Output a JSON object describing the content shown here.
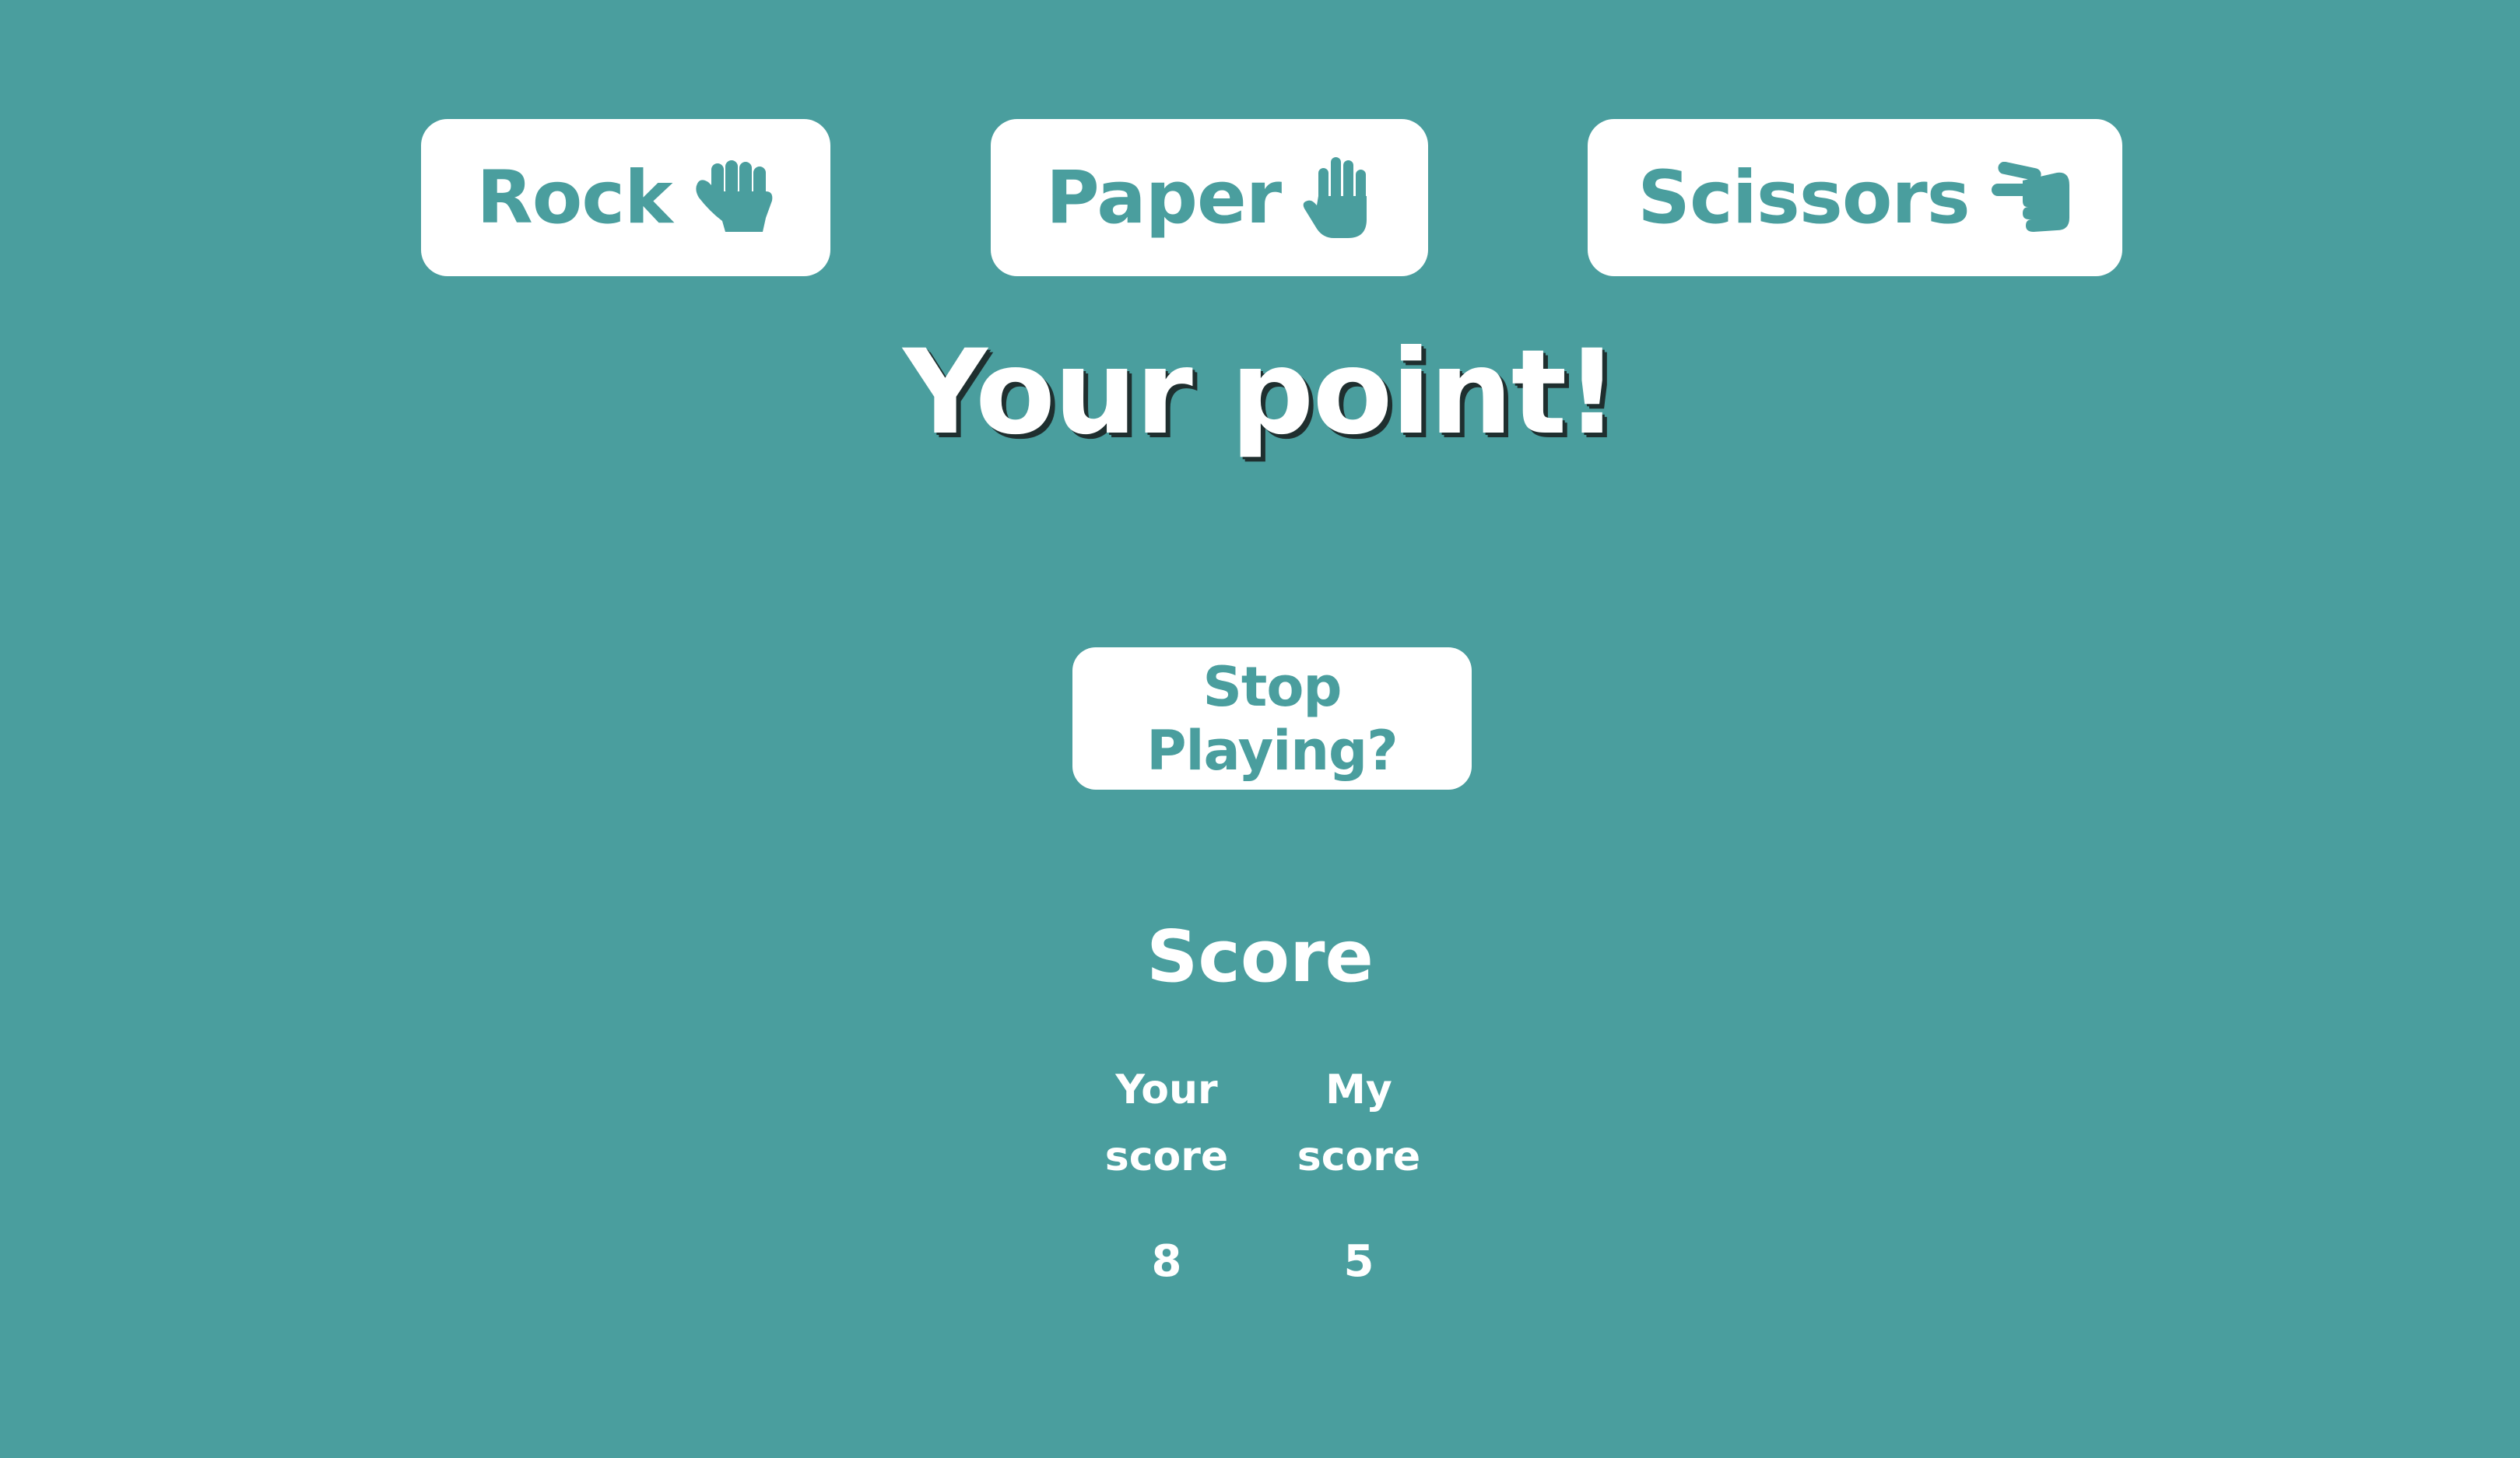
{
  "colors": {
    "background": "#4a9e9e",
    "button_bg": "#ffffff",
    "accent": "#4a9e9e",
    "text": "#ffffff"
  },
  "choices": [
    {
      "label": "Rock",
      "icon": "fist-icon"
    },
    {
      "label": "Paper",
      "icon": "open-hand-icon"
    },
    {
      "label": "Scissors",
      "icon": "scissors-hand-icon"
    }
  ],
  "result": "Your point!",
  "stop_button": "Stop Playing?",
  "score": {
    "title": "Score",
    "your_label": "Your\nscore",
    "my_label": "My\nscore",
    "your_value": "8",
    "my_value": "5"
  }
}
